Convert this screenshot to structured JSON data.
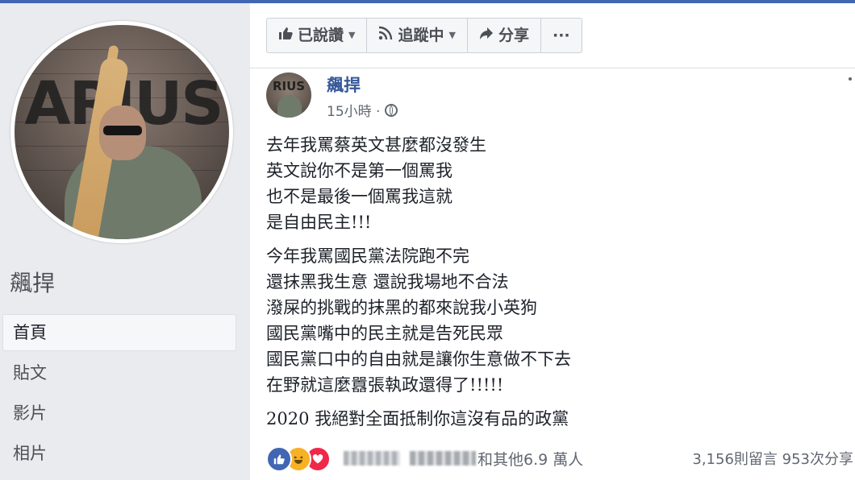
{
  "page": {
    "name": "飆捍"
  },
  "nav": {
    "items": [
      "首頁",
      "貼文",
      "影片",
      "相片"
    ]
  },
  "actions": {
    "liked": "已說讚",
    "following": "追蹤中",
    "share": "分享",
    "more": "···"
  },
  "post": {
    "author": "飆捍",
    "time": "15小時 ·",
    "paragraphs": [
      [
        "去年我罵蔡英文甚麼都沒發生",
        "英文說你不是第一個罵我",
        "也不是最後一個罵我這就",
        "是自由民主!!!"
      ],
      [
        "今年我罵國民黨法院跑不完",
        "還抹黑我生意 還說我場地不合法",
        "潑屎的挑戰的抹黑的都來說我小英狗",
        "國民黨嘴中的民主就是告死民眾",
        "國民黨口中的自由就是讓你生意做不下去",
        "在野就這麼囂張執政還得了!!!!!"
      ],
      [
        "2020 我絕對全面抵制你這沒有品的政黨"
      ]
    ],
    "reactions_text": "和其他6.9 萬人",
    "comments_count": "3,156則留言",
    "shares_count": "953次分享"
  },
  "colors": {
    "accent": "#4267b2",
    "link": "#365899"
  }
}
